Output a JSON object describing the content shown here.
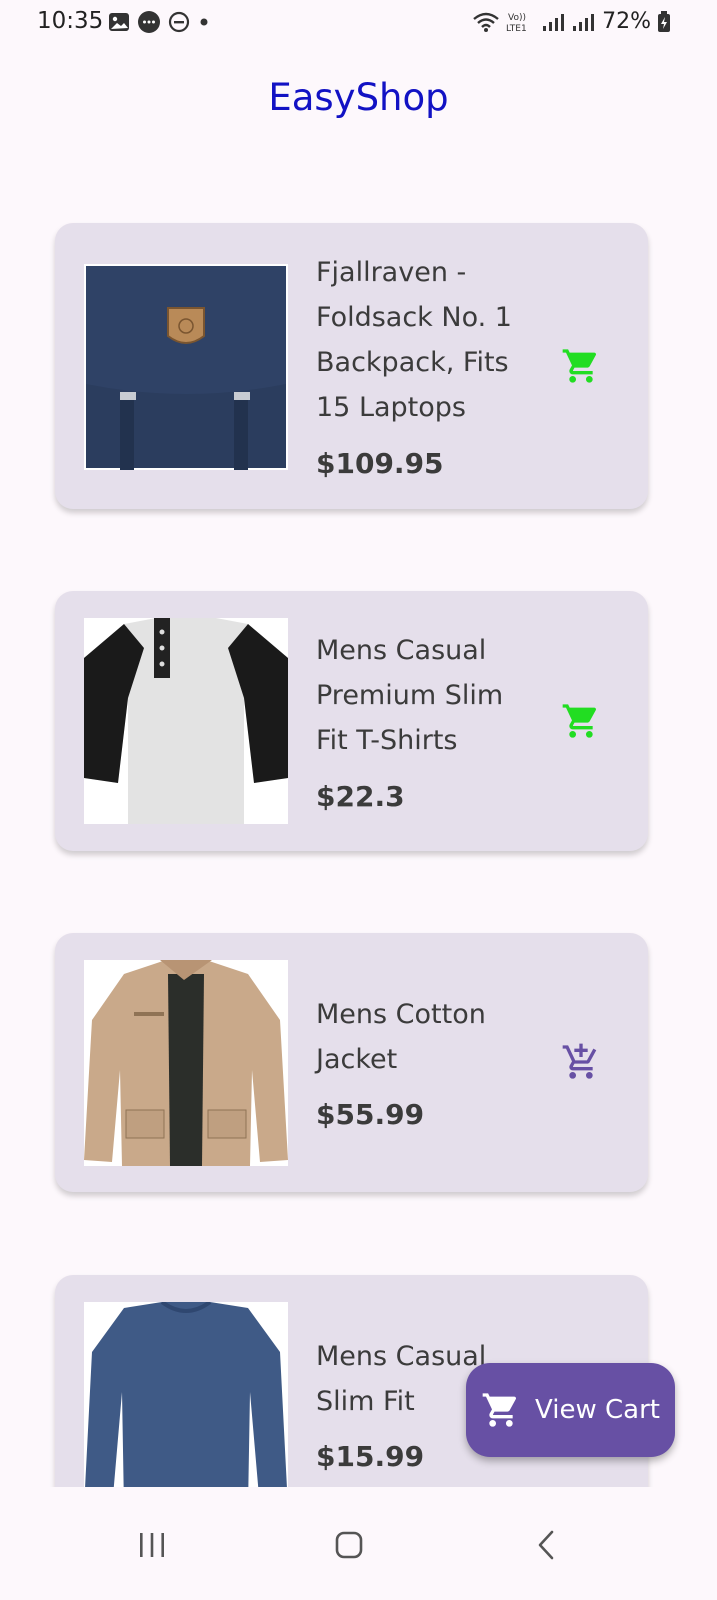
{
  "status_bar": {
    "time": "10:35",
    "battery": "72%",
    "icons_left": [
      "image-icon",
      "message-icon",
      "dnd-icon",
      "dot-icon"
    ],
    "icons_right": [
      "wifi-icon",
      "volte-icon",
      "signal-icon",
      "signal-icon",
      "battery-icon"
    ]
  },
  "app": {
    "title": "EasyShop"
  },
  "products": [
    {
      "title": "Fjallraven - Foldsack No. 1 Backpack, Fits 15 Laptops",
      "price": "$109.95",
      "cart_icon": "cart-icon",
      "cart_color": "#22dd22"
    },
    {
      "title": "Mens Casual Premium Slim Fit T-Shirts",
      "price": "$22.3",
      "cart_icon": "cart-icon",
      "cart_color": "#22dd22"
    },
    {
      "title": "Mens Cotton Jacket",
      "price": "$55.99",
      "cart_icon": "add-to-cart-icon",
      "cart_color": "#6750a4"
    },
    {
      "title": "Mens Casual Slim Fit",
      "price": "$15.99",
      "cart_icon": "add-to-cart-icon",
      "cart_color": "#6750a4"
    }
  ],
  "fab": {
    "label": "View Cart",
    "icon": "cart-icon"
  },
  "colors": {
    "accent": "#6750a4",
    "title": "#1212c4",
    "card": "#e5dfeb",
    "in_cart": "#22dd22"
  },
  "nav": {
    "icons": [
      "recent-apps-icon",
      "home-icon",
      "back-icon"
    ]
  }
}
